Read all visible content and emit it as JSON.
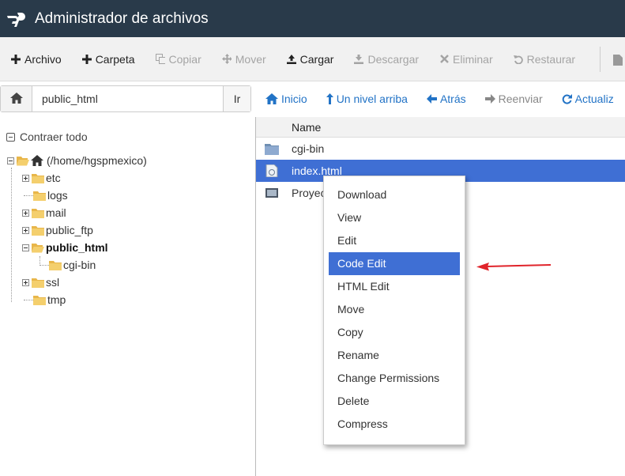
{
  "app": {
    "title": "Administrador de archivos"
  },
  "toolbar": {
    "items": [
      {
        "label": "Archivo",
        "icon": "plus-icon",
        "enabled": true
      },
      {
        "label": "Carpeta",
        "icon": "plus-icon",
        "enabled": true
      },
      {
        "label": "Copiar",
        "icon": "copy-icon",
        "enabled": false
      },
      {
        "label": "Mover",
        "icon": "move-icon",
        "enabled": false
      },
      {
        "label": "Cargar",
        "icon": "upload-icon",
        "enabled": true
      },
      {
        "label": "Descargar",
        "icon": "download-icon",
        "enabled": false
      },
      {
        "label": "Eliminar",
        "icon": "close-icon",
        "enabled": false
      },
      {
        "label": "Restaurar",
        "icon": "undo-icon",
        "enabled": false
      }
    ]
  },
  "pathbar": {
    "value": "public_html",
    "go_label": "Ir"
  },
  "nav": {
    "items": [
      {
        "label": "Inicio",
        "icon": "home-icon",
        "enabled": true
      },
      {
        "label": "Un nivel arriba",
        "icon": "level-up-icon",
        "enabled": true
      },
      {
        "label": "Atrás",
        "icon": "arrow-left-icon",
        "enabled": true
      },
      {
        "label": "Reenviar",
        "icon": "arrow-right-icon",
        "enabled": false
      },
      {
        "label": "Actualiz",
        "icon": "refresh-icon",
        "enabled": true
      }
    ]
  },
  "tree": {
    "collapse_label": "Contraer todo",
    "root_label": "(/home/hgspmexico)",
    "items": [
      {
        "label": "etc",
        "expander": "plus"
      },
      {
        "label": "logs",
        "expander": "none"
      },
      {
        "label": "mail",
        "expander": "plus"
      },
      {
        "label": "public_ftp",
        "expander": "plus"
      },
      {
        "label": "public_html",
        "expander": "minus",
        "bold": true
      },
      {
        "label": "cgi-bin",
        "expander": "none",
        "child": true
      },
      {
        "label": "ssl",
        "expander": "plus"
      },
      {
        "label": "tmp",
        "expander": "none"
      }
    ]
  },
  "files": {
    "column_name": "Name",
    "rows": [
      {
        "name": "cgi-bin",
        "icon": "folder-icon",
        "selected": false
      },
      {
        "name": "index.html",
        "icon": "html-file-icon",
        "selected": true
      },
      {
        "name": "Proyec",
        "icon": "image-file-icon",
        "selected": false
      }
    ]
  },
  "context_menu": {
    "items": [
      {
        "label": "Download",
        "active": false
      },
      {
        "label": "View",
        "active": false
      },
      {
        "label": "Edit",
        "active": false
      },
      {
        "label": "Code Edit",
        "active": true
      },
      {
        "label": "HTML Edit",
        "active": false
      },
      {
        "label": "Move",
        "active": false
      },
      {
        "label": "Copy",
        "active": false
      },
      {
        "label": "Rename",
        "active": false
      },
      {
        "label": "Change Permissions",
        "active": false
      },
      {
        "label": "Delete",
        "active": false
      },
      {
        "label": "Compress",
        "active": false
      }
    ]
  },
  "colors": {
    "header_bg": "#293a4a",
    "selection": "#3f6fd4",
    "link": "#2273c6",
    "annotation_arrow": "#e0242b"
  }
}
